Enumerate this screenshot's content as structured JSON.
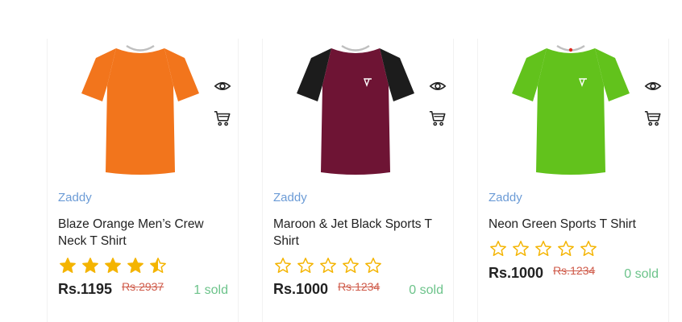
{
  "products": [
    {
      "brand": "Zaddy",
      "title": "Blaze Orange Men’s Crew Neck T Shirt",
      "rating": 4.5,
      "price": "Rs.1195",
      "old_price": "Rs.2937",
      "sold": "1 sold",
      "shirt_color": "#f2751c",
      "sleeve_color": "#f2751c",
      "image_icon": "orange-tshirt"
    },
    {
      "brand": "Zaddy",
      "title": "Maroon & Jet Black Sports T Shirt",
      "rating": 0,
      "price": "Rs.1000",
      "old_price": "Rs.1234",
      "sold": "0 sold",
      "shirt_color": "#6e1434",
      "sleeve_color": "#1c1c1c",
      "image_icon": "maroon-black-tshirt"
    },
    {
      "brand": "Zaddy",
      "title": "Neon Green Sports T Shirt",
      "rating": 0,
      "price": "Rs.1000",
      "old_price": "Rs.1234",
      "sold": "0 sold",
      "shirt_color": "#62c21c",
      "sleeve_color": "#62c21c",
      "image_icon": "green-tshirt"
    }
  ],
  "colors": {
    "brand": "#6b9bd6",
    "star": "#f4b400",
    "old_price": "#cf5b4a",
    "sold": "#6cc38a"
  }
}
